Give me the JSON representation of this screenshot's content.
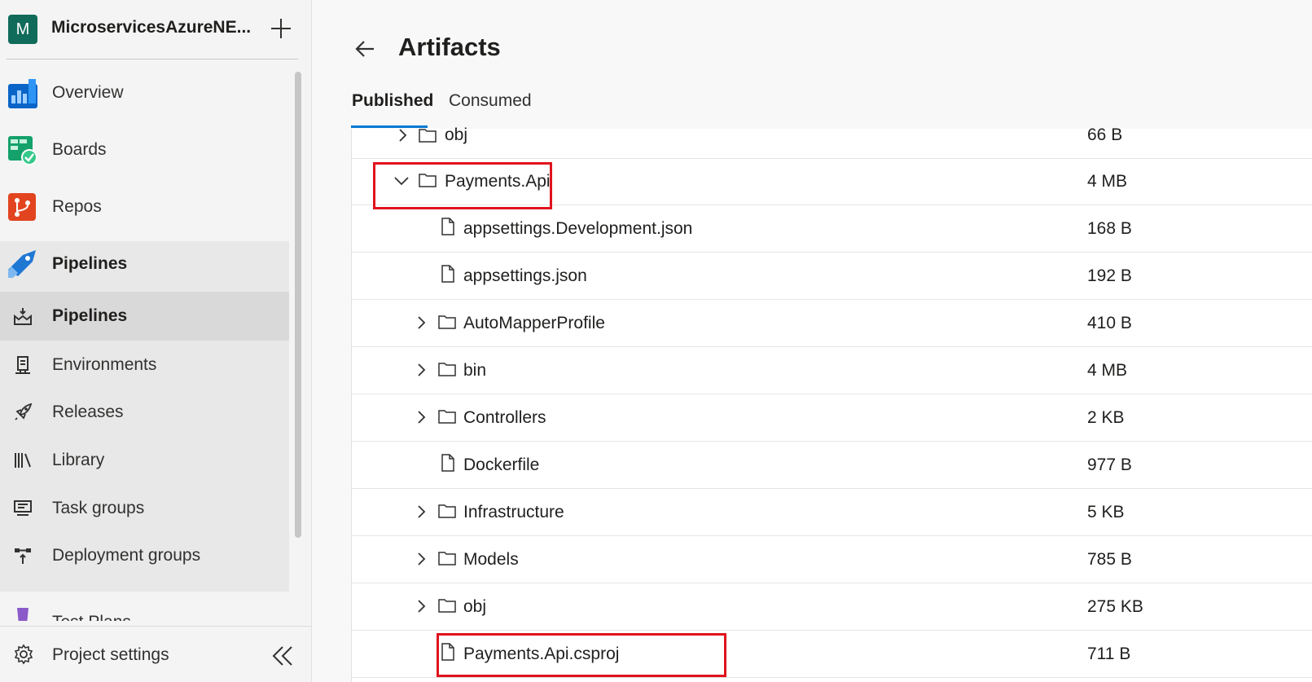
{
  "sidebar": {
    "project_initial": "M",
    "project_name": "MicroservicesAzureNE...",
    "items": [
      {
        "label": "Overview",
        "icon": "overview-icon"
      },
      {
        "label": "Boards",
        "icon": "boards-icon"
      },
      {
        "label": "Repos",
        "icon": "repos-icon"
      },
      {
        "label": "Pipelines",
        "icon": "pipelines-icon"
      }
    ],
    "pipelines_sub": [
      {
        "label": "Pipelines",
        "icon": "pipelines-sub-icon",
        "selected": true
      },
      {
        "label": "Environments",
        "icon": "environments-icon"
      },
      {
        "label": "Releases",
        "icon": "releases-icon"
      },
      {
        "label": "Library",
        "icon": "library-icon"
      },
      {
        "label": "Task groups",
        "icon": "task-groups-icon"
      },
      {
        "label": "Deployment groups",
        "icon": "deployment-groups-icon"
      }
    ],
    "cut_item": "Test Plans",
    "settings_label": "Project settings",
    "colors": {
      "avatar": "#106b5a",
      "selected_bg": "#d9d9d9",
      "group_bg": "#e8e8e8"
    }
  },
  "main": {
    "title": "Artifacts",
    "tabs": [
      {
        "label": "Published",
        "active": true
      },
      {
        "label": "Consumed",
        "active": false
      }
    ],
    "rows": [
      {
        "name": "obj",
        "size": "66 B",
        "type": "folder",
        "expanded": false,
        "level": 0
      },
      {
        "name": "Payments.Api",
        "size": "4 MB",
        "type": "folder",
        "expanded": true,
        "level": 0,
        "highlighted": true
      },
      {
        "name": "appsettings.Development.json",
        "size": "168 B",
        "type": "file",
        "level": 1
      },
      {
        "name": "appsettings.json",
        "size": "192 B",
        "type": "file",
        "level": 1
      },
      {
        "name": "AutoMapperProfile",
        "size": "410 B",
        "type": "folder",
        "expanded": false,
        "level": 1
      },
      {
        "name": "bin",
        "size": "4 MB",
        "type": "folder",
        "expanded": false,
        "level": 1
      },
      {
        "name": "Controllers",
        "size": "2 KB",
        "type": "folder",
        "expanded": false,
        "level": 1
      },
      {
        "name": "Dockerfile",
        "size": "977 B",
        "type": "file",
        "level": 1
      },
      {
        "name": "Infrastructure",
        "size": "5 KB",
        "type": "folder",
        "expanded": false,
        "level": 1
      },
      {
        "name": "Models",
        "size": "785 B",
        "type": "folder",
        "expanded": false,
        "level": 1
      },
      {
        "name": "obj",
        "size": "275 KB",
        "type": "folder",
        "expanded": false,
        "level": 1
      },
      {
        "name": "Payments.Api.csproj",
        "size": "711 B",
        "type": "file",
        "level": 1,
        "highlighted": true
      }
    ],
    "colors": {
      "accent": "#0078d4",
      "highlight": "#e0131d"
    }
  }
}
